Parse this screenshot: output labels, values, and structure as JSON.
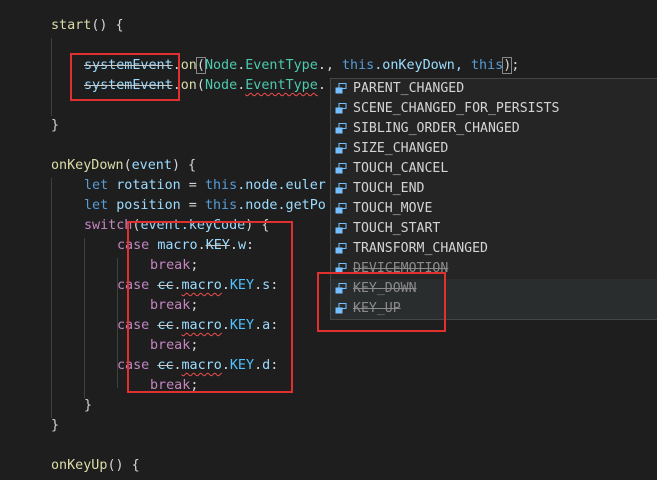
{
  "code": {
    "start_fn": "start",
    "start_parens": "() {",
    "line1": {
      "target": "systemEvent",
      "method": "on",
      "node_cls": "Node",
      "event_type": "EventType",
      "rest_a": "., ",
      "this1": "this",
      "handler": ".onKeyDown, ",
      "this2": "this",
      "close": ");"
    },
    "line2": {
      "target": "systemEvent",
      "method": "on",
      "node_cls": "Node",
      "event_type": "EventType",
      "rest_a": "."
    },
    "close_brace": "}",
    "keydown_fn": "onKeyDown",
    "keydown_param": "event",
    "keydown_open": ") {",
    "let1_kw": "let",
    "let1_var": "rotation",
    "let1_rest_a": " = ",
    "let1_this": "this",
    "let1_rest_b": ".node.euler",
    "let2_kw": "let",
    "let2_var": "position",
    "let2_rest_a": " = ",
    "let2_this": "this",
    "let2_rest_b": ".node.getPo",
    "switch_kw": "switch",
    "switch_arg": "event.keyCode",
    "switch_open": ") {",
    "cases": [
      {
        "kw": "case",
        "ns": "",
        "macro": "macro",
        "key": "KEY",
        "prop": "w",
        "key_strike": true
      },
      {
        "kw": "case",
        "ns": "cc",
        "macro": "macro",
        "key": "KEY",
        "prop": "s",
        "key_strike": false
      },
      {
        "kw": "case",
        "ns": "cc",
        "macro": "macro",
        "key": "KEY",
        "prop": "a",
        "key_strike": false
      },
      {
        "kw": "case",
        "ns": "cc",
        "macro": "macro",
        "key": "KEY",
        "prop": "d",
        "key_strike": false
      }
    ],
    "break_kw": "break",
    "keyup_fn": "onKeyUp",
    "keyup_open": "() {"
  },
  "suggestions": {
    "items": [
      {
        "label": "PARENT_CHANGED",
        "deprecated": false
      },
      {
        "label": "SCENE_CHANGED_FOR_PERSISTS",
        "deprecated": false
      },
      {
        "label": "SIBLING_ORDER_CHANGED",
        "deprecated": false
      },
      {
        "label": "SIZE_CHANGED",
        "deprecated": false
      },
      {
        "label": "TOUCH_CANCEL",
        "deprecated": false
      },
      {
        "label": "TOUCH_END",
        "deprecated": false
      },
      {
        "label": "TOUCH_MOVE",
        "deprecated": false
      },
      {
        "label": "TOUCH_START",
        "deprecated": false
      },
      {
        "label": "TRANSFORM_CHANGED",
        "deprecated": false
      },
      {
        "label": "DEVICEMOTION",
        "deprecated": true
      },
      {
        "label": "KEY_DOWN",
        "deprecated": true
      },
      {
        "label": "KEY_UP",
        "deprecated": true
      }
    ],
    "icon": "enum-member-icon"
  },
  "colors": {
    "annotation_box": "#e03030",
    "background": "#1e1e1e",
    "suggest_bg": "#252526",
    "enum_icon": "#75beff"
  }
}
